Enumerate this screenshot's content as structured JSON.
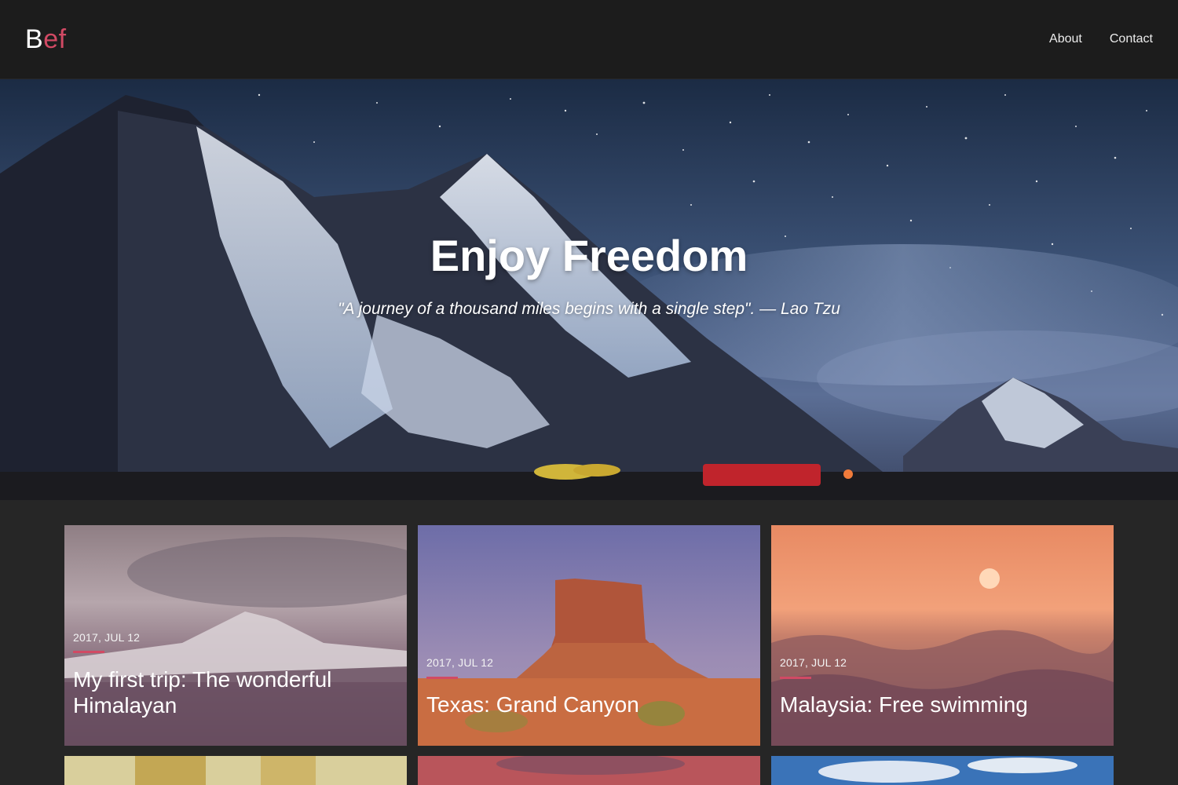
{
  "brand": {
    "first": "B",
    "rest": "ef"
  },
  "nav": [
    {
      "label": "About"
    },
    {
      "label": "Contact"
    }
  ],
  "hero": {
    "title": "Enjoy Freedom",
    "quote": "\"A journey of a thousand miles begins with a single step\". — Lao Tzu"
  },
  "posts": [
    {
      "date": "2017, JUL 12",
      "title": "My first trip: The wonderful Himalayan"
    },
    {
      "date": "2017, JUL 12",
      "title": "Texas: Grand Canyon"
    },
    {
      "date": "2017, JUL 12",
      "title": "Malaysia: Free swimming"
    }
  ],
  "colors": {
    "accent": "#d14a64",
    "header_bg": "#1c1c1c",
    "page_bg": "#262626"
  }
}
